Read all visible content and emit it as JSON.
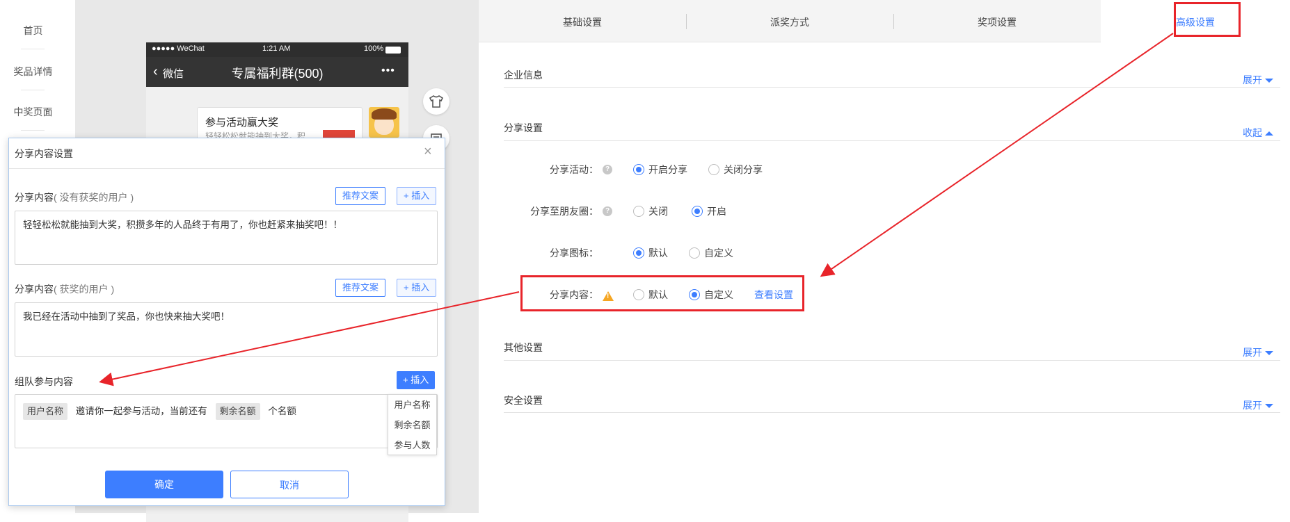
{
  "nav": {
    "items": [
      "首页",
      "奖品详情",
      "中奖页面"
    ]
  },
  "phone": {
    "status": {
      "carrier": "●●●●● WeChat",
      "time": "1:21 AM",
      "battery": "100%"
    },
    "header": {
      "back": "微信",
      "title": "专属福利群(500)",
      "more": "•••"
    },
    "message": {
      "title": "参与活动赢大奖",
      "desc": "轻轻松松就能抽到大奖，积"
    }
  },
  "tabs": [
    "基础设置",
    "派奖方式",
    "奖项设置",
    "高级设置"
  ],
  "sections": {
    "enterprise": {
      "title": "企业信息",
      "toggle": "展开"
    },
    "share": {
      "title": "分享设置",
      "toggle": "收起"
    },
    "other": {
      "title": "其他设置",
      "toggle": "展开"
    },
    "security": {
      "title": "安全设置",
      "toggle": "展开"
    }
  },
  "share_rows": {
    "activity": {
      "label": "分享活动：",
      "options": [
        "开启分享",
        "关闭分享"
      ],
      "selected": 0
    },
    "moments": {
      "label": "分享至朋友圈：",
      "options": [
        "关闭",
        "开启"
      ],
      "selected": 1
    },
    "icon": {
      "label": "分享图标：",
      "options": [
        "默认",
        "自定义"
      ],
      "selected": 0
    },
    "content": {
      "label": "分享内容：",
      "options": [
        "默认",
        "自定义"
      ],
      "selected": 1,
      "link": "查看设置"
    }
  },
  "dialog": {
    "title": "分享内容设置",
    "field1": {
      "label": "分享内容",
      "sub": "( 没有获奖的用户 )",
      "value": "轻轻松松就能抽到大奖，积攒多年的人品终于有用了，你也赶紧来抽奖吧！！"
    },
    "field2": {
      "label": "分享内容",
      "sub": "( 获奖的用户 )",
      "value": "我已经在活动中抽到了奖品，你也快来抽大奖吧！"
    },
    "field3": {
      "label": "组队参与内容",
      "tag1": "用户名称",
      "text1": "邀请你一起参与活动，当前还有",
      "tag2": "剩余名额",
      "text2": "个名额"
    },
    "recommend_btn": "推荐文案",
    "insert_btn": "+ 插入",
    "dropdown": [
      "用户名称",
      "剩余名额",
      "参与人数"
    ],
    "ok": "确定",
    "cancel": "取消"
  },
  "colors": {
    "accent": "#3d7eff",
    "annotation": "#e8242a",
    "warning": "#f5a623"
  }
}
